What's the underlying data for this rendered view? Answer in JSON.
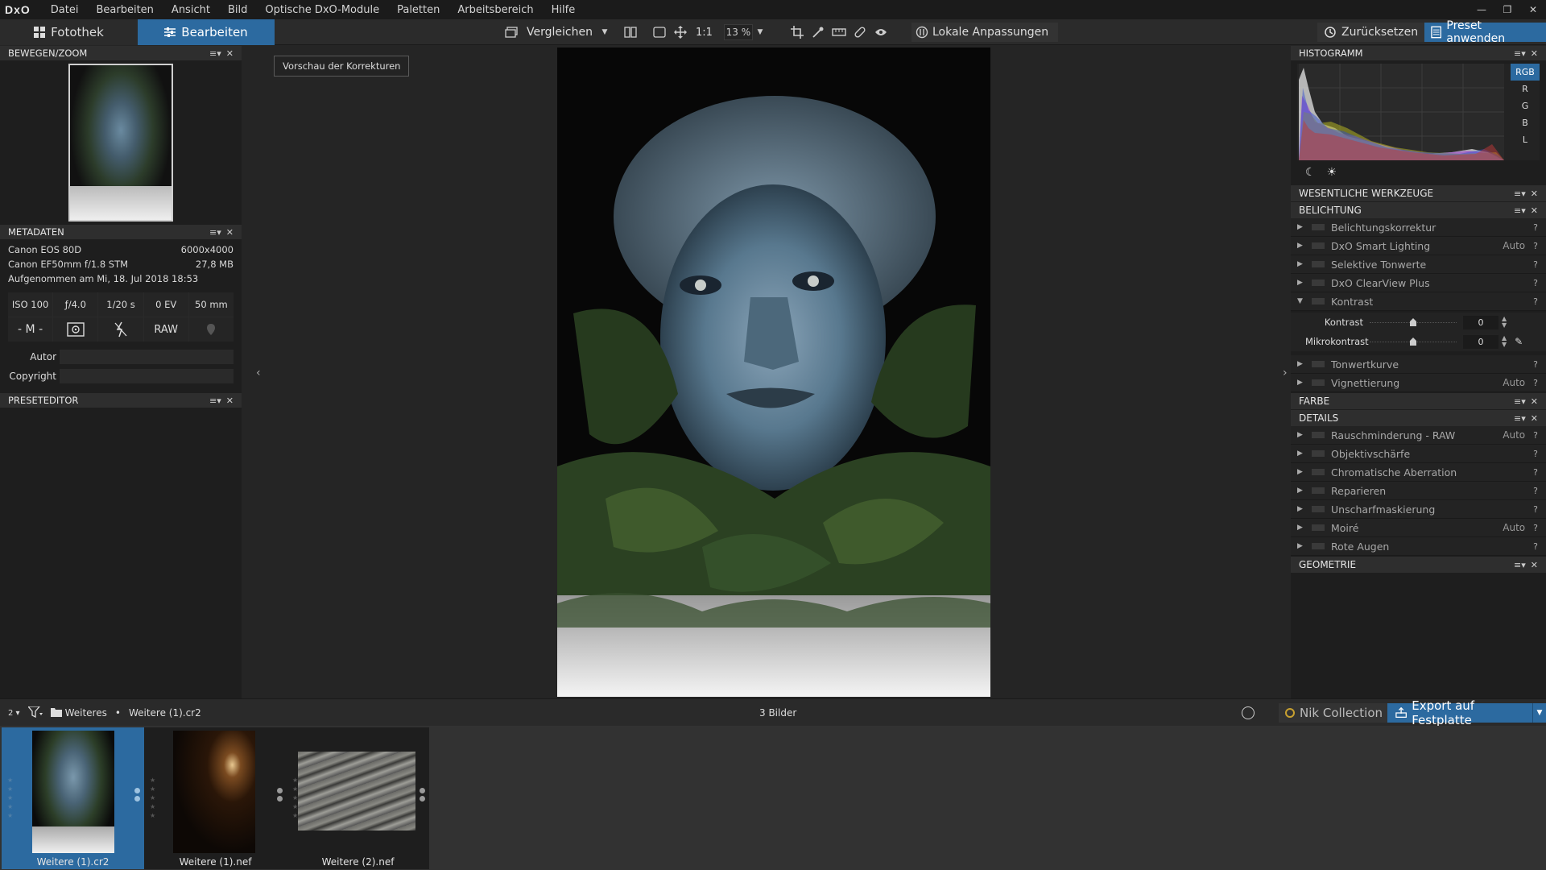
{
  "menubar": {
    "logo": "DxO",
    "items": [
      "Datei",
      "Bearbeiten",
      "Ansicht",
      "Bild",
      "Optische DxO-Module",
      "Paletten",
      "Arbeitsbereich",
      "Hilfe"
    ]
  },
  "toolbar": {
    "tab_fotothek": "Fotothek",
    "tab_bearbeiten": "Bearbeiten",
    "compare_label": "Vergleichen",
    "one_to_one": "1:1",
    "zoom_value": "13 %",
    "local_adjust_label": "Lokale Anpassungen",
    "reset_label": "Zurücksetzen",
    "preset_label": "Preset anwenden"
  },
  "left_panel": {
    "move_zoom_title": "BEWEGEN/ZOOM",
    "metadata_title": "METADATEN",
    "camera": "Canon EOS 80D",
    "dimensions": "6000x4000",
    "lens": "Canon EF50mm f/1.8 STM",
    "filesize": "27,8 MB",
    "taken": "Aufgenommen am Mi, 18. Jul 2018 18:53",
    "exif": [
      "ISO 100",
      "ƒ/4.0",
      "1/20 s",
      "0 EV",
      "50 mm"
    ],
    "mode": "- M -",
    "raw": "RAW",
    "author_label": "Autor",
    "copyright_label": "Copyright",
    "preset_editor_title": "PRESETEDITOR"
  },
  "center": {
    "preview_btn": "Vorschau der Korrekturen"
  },
  "right_panel": {
    "histogram_title": "HISTOGRAMM",
    "channels": [
      "RGB",
      "R",
      "G",
      "B",
      "L"
    ],
    "essential_title": "WESENTLICHE WERKZEUGE",
    "exposure_title": "BELICHTUNG",
    "exposure_tools": [
      {
        "label": "Belichtungskorrektur",
        "auto": ""
      },
      {
        "label": "DxO Smart Lighting",
        "auto": "Auto"
      },
      {
        "label": "Selektive Tonwerte",
        "auto": ""
      },
      {
        "label": "DxO ClearView Plus",
        "auto": ""
      },
      {
        "label": "Kontrast",
        "auto": ""
      }
    ],
    "sliders": [
      {
        "label": "Kontrast",
        "value": "0"
      },
      {
        "label": "Mikrokontrast",
        "value": "0"
      }
    ],
    "exposure_tools2": [
      {
        "label": "Tonwertkurve",
        "auto": ""
      },
      {
        "label": "Vignettierung",
        "auto": "Auto"
      }
    ],
    "color_title": "FARBE",
    "details_title": "DETAILS",
    "details_tools": [
      {
        "label": "Rauschminderung - RAW",
        "auto": "Auto"
      },
      {
        "label": "Objektivschärfe",
        "auto": ""
      },
      {
        "label": "Chromatische Aberration",
        "auto": ""
      },
      {
        "label": "Reparieren",
        "auto": ""
      },
      {
        "label": "Unscharfmaskierung",
        "auto": ""
      },
      {
        "label": "Moiré",
        "auto": "Auto"
      },
      {
        "label": "Rote Augen",
        "auto": ""
      }
    ],
    "geometry_title": "GEOMETRIE",
    "help": "?"
  },
  "filmbar": {
    "sort": "2",
    "folder": "Weiteres",
    "file": "Weitere (1).cr2",
    "count": "3 Bilder",
    "nik_label": "Nik Collection",
    "export_label": "Export auf Festplatte"
  },
  "filmstrip": [
    {
      "label": "Weitere (1).cr2",
      "selected": true
    },
    {
      "label": "Weitere (1).nef",
      "selected": false
    },
    {
      "label": "Weitere (2).nef",
      "selected": false
    }
  ],
  "colors": {
    "accent": "#2c6aa0",
    "panel": "#1e1e1e",
    "header": "#2e2e2e"
  }
}
